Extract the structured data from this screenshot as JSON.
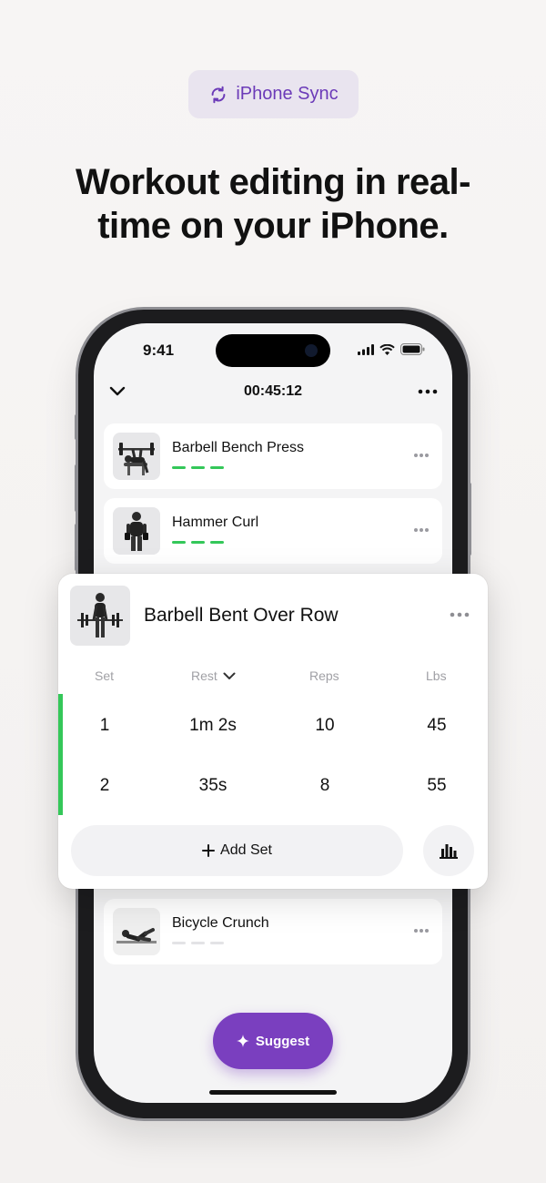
{
  "badge": {
    "label": "iPhone Sync",
    "icon": "sync-icon",
    "color": "#6b3ab8"
  },
  "headline": {
    "line1": "Workout editing in real-",
    "line2": "time on your iPhone."
  },
  "status_bar": {
    "time": "9:41",
    "icons": [
      "cellular-icon",
      "wifi-icon",
      "battery-icon"
    ]
  },
  "nav": {
    "timer": "00:45:12",
    "back_icon": "chevron-down-icon",
    "menu_icon": "more-icon"
  },
  "exercises": [
    {
      "name": "Barbell Bench Press",
      "sets_complete": 3,
      "sets_total": 3
    },
    {
      "name": "Hammer Curl",
      "sets_complete": 3,
      "sets_total": 3
    },
    {
      "name": "Bicycle Crunch",
      "sets_complete": 0,
      "sets_total": 3
    }
  ],
  "active_exercise": {
    "name": "Barbell Bent Over Row",
    "columns": {
      "set": "Set",
      "rest": "Rest",
      "reps": "Reps",
      "lbs": "Lbs"
    },
    "rows": [
      {
        "set": "1",
        "rest": "1m 2s",
        "reps": "10",
        "lbs": "45"
      },
      {
        "set": "2",
        "rest": "35s",
        "reps": "8",
        "lbs": "55"
      }
    ],
    "add_set_label": "Add Set"
  },
  "suggest_button": {
    "label": "Suggest"
  },
  "colors": {
    "accent": "#7a3fbf",
    "complete": "#34c759",
    "incomplete": "#e3e3e6"
  }
}
